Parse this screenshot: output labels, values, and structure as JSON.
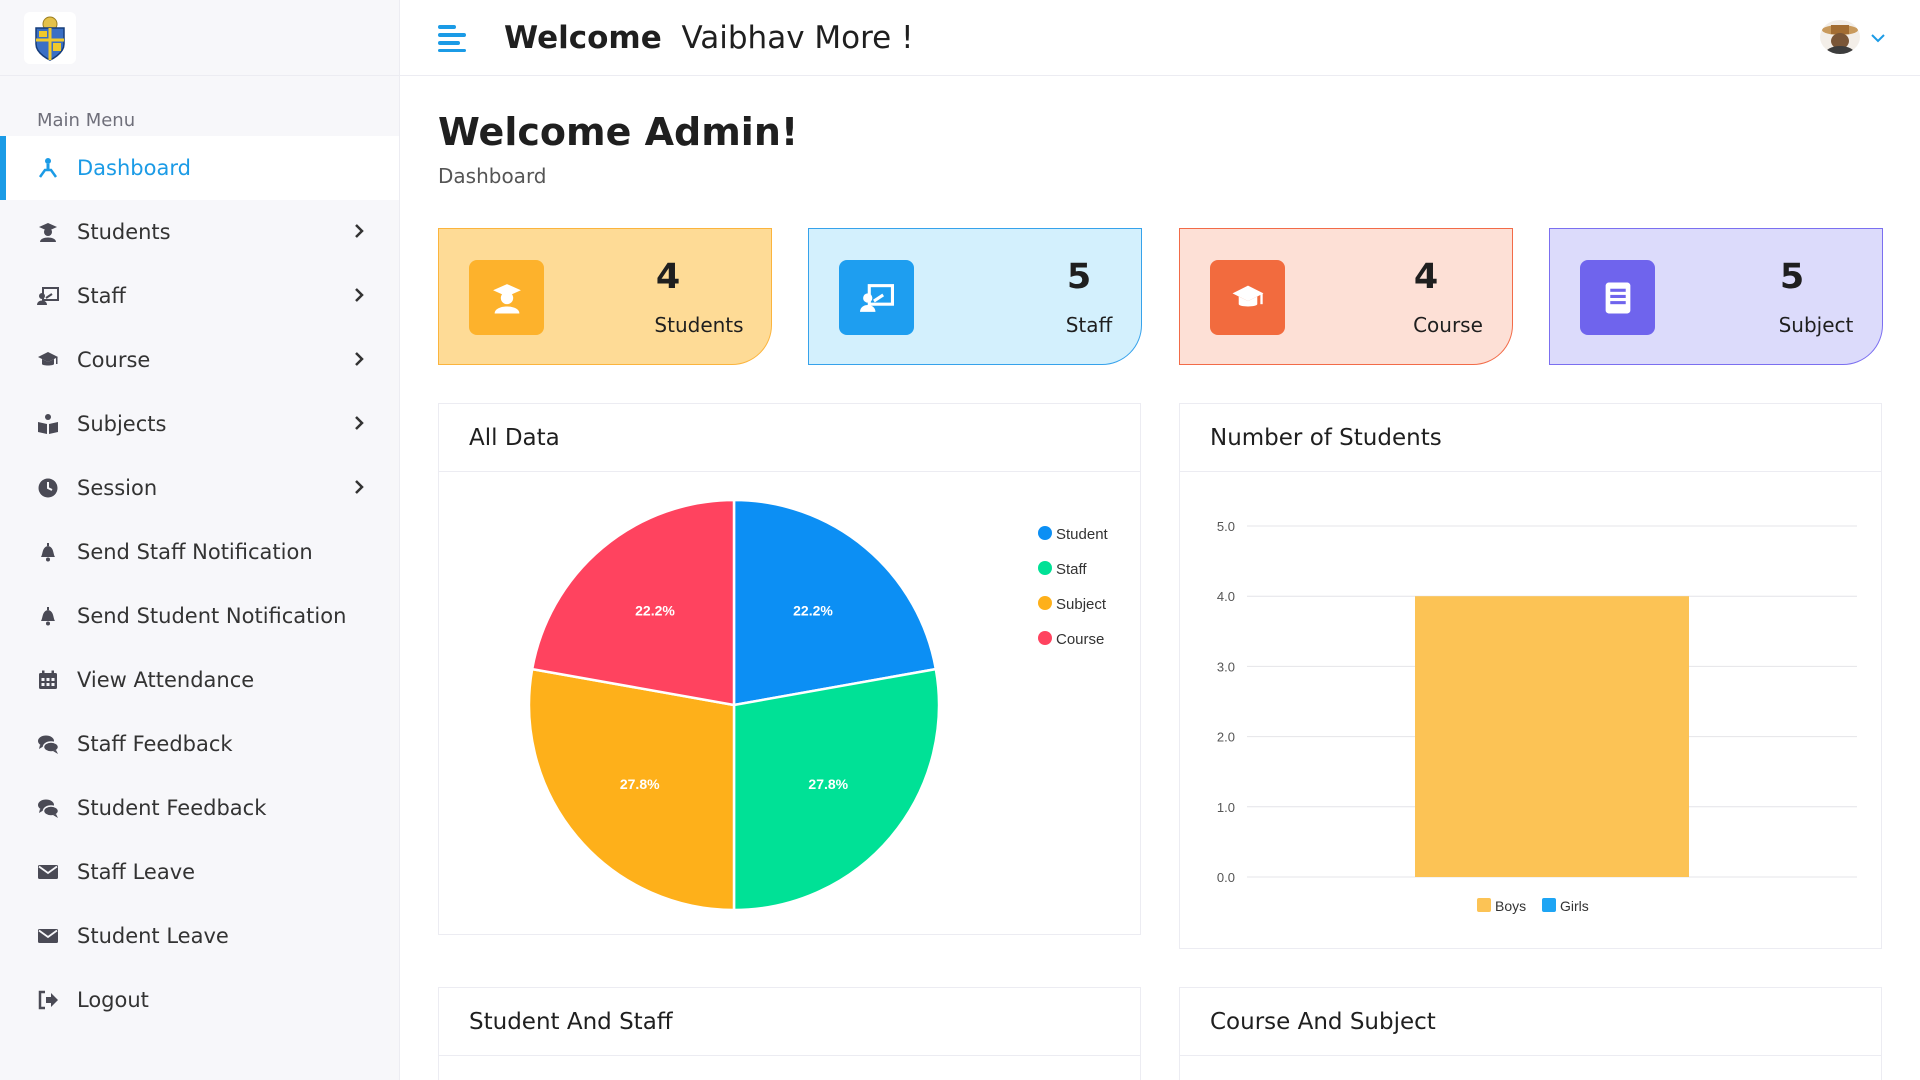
{
  "topbar": {
    "welcome_bold": "Welcome",
    "welcome_name": "Vaibhav More !"
  },
  "sidebar": {
    "menu_title": "Main Menu",
    "items": [
      {
        "label": "Dashboard",
        "icon": "dashboard-icon",
        "active": true,
        "chevron": false
      },
      {
        "label": "Students",
        "icon": "student-icon",
        "chevron": true
      },
      {
        "label": "Staff",
        "icon": "staff-board-icon",
        "chevron": true
      },
      {
        "label": "Course",
        "icon": "graduation-cap-icon",
        "chevron": true
      },
      {
        "label": "Subjects",
        "icon": "book-reader-icon",
        "chevron": true
      },
      {
        "label": "Session",
        "icon": "clock-icon",
        "chevron": true
      },
      {
        "label": "Send Staff Notification",
        "icon": "bell-icon",
        "chevron": false
      },
      {
        "label": "Send Student Notification",
        "icon": "bell-icon",
        "chevron": false
      },
      {
        "label": "View Attendance",
        "icon": "calendar-icon",
        "chevron": false
      },
      {
        "label": "Staff Feedback",
        "icon": "comments-icon",
        "chevron": false
      },
      {
        "label": "Student Feedback",
        "icon": "comments-icon",
        "chevron": false
      },
      {
        "label": "Staff Leave",
        "icon": "envelope-icon",
        "chevron": false
      },
      {
        "label": "Student Leave",
        "icon": "envelope-icon",
        "chevron": false
      },
      {
        "label": "Logout",
        "icon": "logout-icon",
        "chevron": false
      }
    ]
  },
  "page": {
    "title": "Welcome Admin!",
    "subtitle": "Dashboard"
  },
  "stats": [
    {
      "value": "4",
      "label": "Students",
      "icon": "student-icon",
      "bg": "#fedb96",
      "border": "#fbb43d",
      "icon_bg": "#fdb22c"
    },
    {
      "value": "5",
      "label": "Staff",
      "icon": "staff-board-icon",
      "bg": "#d3f0fd",
      "border": "#36a2eb",
      "icon_bg": "#1e9ef0"
    },
    {
      "value": "4",
      "label": "Course",
      "icon": "graduation-cap-icon",
      "bg": "#fde0d6",
      "border": "#f26b48",
      "icon_bg": "#f26b3e"
    },
    {
      "value": "5",
      "label": "Subject",
      "icon": "book-icon",
      "bg": "#dcdbfb",
      "border": "#7b6ff0",
      "icon_bg": "#6f64ed"
    }
  ],
  "cards": {
    "all_data": "All Data",
    "num_students": "Number of Students",
    "student_staff": "Student And Staff",
    "course_subject": "Course And Subject"
  },
  "chart_data": [
    {
      "type": "pie",
      "title": "All Data",
      "legend_position": "top-right",
      "slices": [
        {
          "label": "Student",
          "percent": 22.2,
          "color": "#0c8ff4"
        },
        {
          "label": "Staff",
          "percent": 27.8,
          "color": "#00e196"
        },
        {
          "label": "Subject",
          "percent": 27.8,
          "color": "#feb01a"
        },
        {
          "label": "Course",
          "percent": 22.2,
          "color": "#ff435f"
        }
      ],
      "slice_labels": [
        "22.2%",
        "27.8%",
        "27.8%",
        "22.2%"
      ]
    },
    {
      "type": "bar",
      "title": "Number of Students",
      "categories": [
        ""
      ],
      "series": [
        {
          "name": "Boys",
          "values": [
            4
          ],
          "color": "#fcc355"
        },
        {
          "name": "Girls",
          "values": [
            0
          ],
          "color": "#1ea5f4"
        }
      ],
      "ylim": [
        0,
        5
      ],
      "yticks": [
        "0.0",
        "1.0",
        "2.0",
        "3.0",
        "4.0",
        "5.0"
      ],
      "grid": true,
      "legend_position": "bottom"
    }
  ]
}
